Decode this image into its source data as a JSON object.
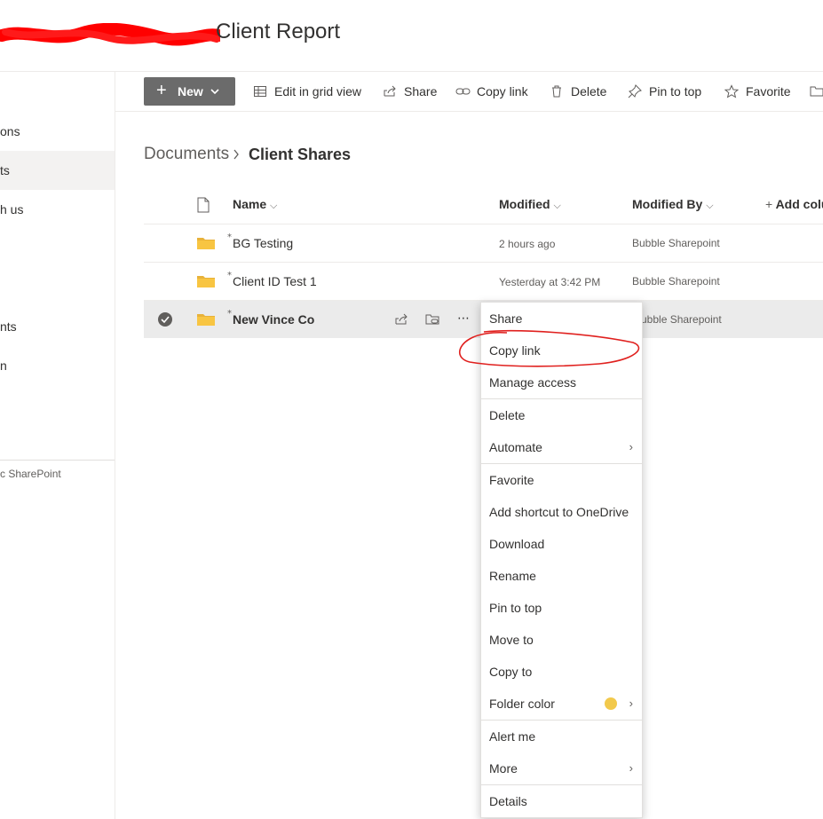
{
  "site": {
    "title": "Client Report"
  },
  "nav": {
    "items": [
      {
        "label": "ons",
        "selected": false
      },
      {
        "label": "ts",
        "selected": true
      },
      {
        "label": "h us",
        "selected": false
      },
      {
        "label": "nts",
        "selected": false
      },
      {
        "label": "n",
        "selected": false
      }
    ],
    "footer": "c SharePoint"
  },
  "commandbar": {
    "new_label": "New",
    "edit_grid_label": "Edit in grid view",
    "share_label": "Share",
    "copy_link_label": "Copy link",
    "delete_label": "Delete",
    "pin_label": "Pin to top",
    "favorite_label": "Favorite"
  },
  "breadcrumb": {
    "root": "Documents",
    "current": "Client Shares"
  },
  "table": {
    "columns": {
      "name": "Name",
      "modified": "Modified",
      "modified_by": "Modified By",
      "add_column": "Add colu"
    },
    "rows": [
      {
        "name": "BG Testing",
        "modified": "2 hours ago",
        "modified_by": "Bubble Sharepoint",
        "selected": false
      },
      {
        "name": "Client ID Test 1",
        "modified": "Yesterday at 3:42 PM",
        "modified_by": "Bubble Sharepoint",
        "selected": false
      },
      {
        "name": "New Vince Co",
        "modified": "",
        "modified_by": "ubble Sharepoint",
        "selected": true
      }
    ]
  },
  "context_menu": {
    "items": [
      "Share",
      "Copy link",
      "Manage access",
      "Delete",
      "Automate",
      "Favorite",
      "Add shortcut to OneDrive",
      "Download",
      "Rename",
      "Pin to top",
      "Move to",
      "Copy to",
      "Folder color",
      "Alert me",
      "More",
      "Details"
    ],
    "folder_color_swatch": "#f2c94c"
  },
  "colors": {
    "annotation": "#e0201e",
    "redaction": "#ff0000",
    "new_button": "#6b6b6b",
    "folder": "#f8c542"
  }
}
